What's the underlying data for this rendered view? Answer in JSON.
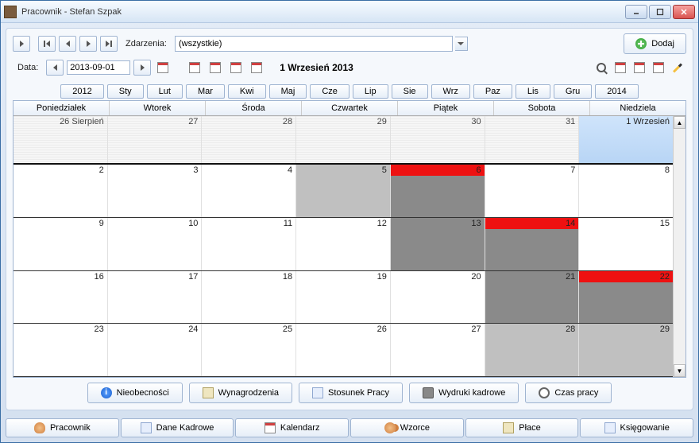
{
  "window": {
    "title": "Pracownik - Stefan Szpak"
  },
  "toolbar": {
    "events_label": "Zdarzenia:",
    "events_value": "(wszystkie)",
    "add_label": "Dodaj",
    "date_label": "Data:",
    "date_value": "2013-09-01",
    "date_title": "1 Wrzesień 2013"
  },
  "nav": {
    "prev_year": "2012",
    "next_year": "2014",
    "months": [
      "Sty",
      "Lut",
      "Mar",
      "Kwi",
      "Maj",
      "Cze",
      "Lip",
      "Sie",
      "Wrz",
      "Paz",
      "Lis",
      "Gru"
    ]
  },
  "dow": [
    "Poniedziałek",
    "Wtorek",
    "Środa",
    "Czwartek",
    "Piątek",
    "Sobota",
    "Niedziela"
  ],
  "weeks": [
    [
      {
        "label": "26 Sierpień",
        "prev": true
      },
      {
        "label": "27",
        "prev": true
      },
      {
        "label": "28",
        "prev": true
      },
      {
        "label": "29",
        "prev": true
      },
      {
        "label": "30",
        "prev": true
      },
      {
        "label": "31",
        "prev": true
      },
      {
        "label": "1 Wrzesień",
        "selected": true
      }
    ],
    [
      {
        "label": "2"
      },
      {
        "label": "3"
      },
      {
        "label": "4"
      },
      {
        "label": "5",
        "shade": "light"
      },
      {
        "label": "6",
        "shade": "dark",
        "red": true
      },
      {
        "label": "7"
      },
      {
        "label": "8"
      }
    ],
    [
      {
        "label": "9"
      },
      {
        "label": "10"
      },
      {
        "label": "11"
      },
      {
        "label": "12"
      },
      {
        "label": "13",
        "shade": "dark"
      },
      {
        "label": "14",
        "shade": "dark",
        "red": true
      },
      {
        "label": "15"
      }
    ],
    [
      {
        "label": "16"
      },
      {
        "label": "17"
      },
      {
        "label": "18"
      },
      {
        "label": "19"
      },
      {
        "label": "20"
      },
      {
        "label": "21",
        "shade": "dark"
      },
      {
        "label": "22",
        "shade": "dark",
        "red": true
      }
    ],
    [
      {
        "label": "23"
      },
      {
        "label": "24"
      },
      {
        "label": "25"
      },
      {
        "label": "26"
      },
      {
        "label": "27"
      },
      {
        "label": "28",
        "shade": "light"
      },
      {
        "label": "29",
        "shade": "light"
      }
    ]
  ],
  "sub_tabs": [
    {
      "label": "Nieobecności",
      "icon": "info"
    },
    {
      "label": "Wynagrodzenia",
      "icon": "doc"
    },
    {
      "label": "Stosunek Pracy",
      "icon": "doc2"
    },
    {
      "label": "Wydruki kadrowe",
      "icon": "print"
    },
    {
      "label": "Czas pracy",
      "icon": "clock"
    }
  ],
  "bottom_tabs": [
    {
      "label": "Pracownik",
      "icon": "user"
    },
    {
      "label": "Dane Kadrowe",
      "icon": "doc2"
    },
    {
      "label": "Kalendarz",
      "icon": "cal"
    },
    {
      "label": "Wzorce",
      "icon": "users"
    },
    {
      "label": "Płace",
      "icon": "money"
    },
    {
      "label": "Księgowanie",
      "icon": "book"
    }
  ]
}
